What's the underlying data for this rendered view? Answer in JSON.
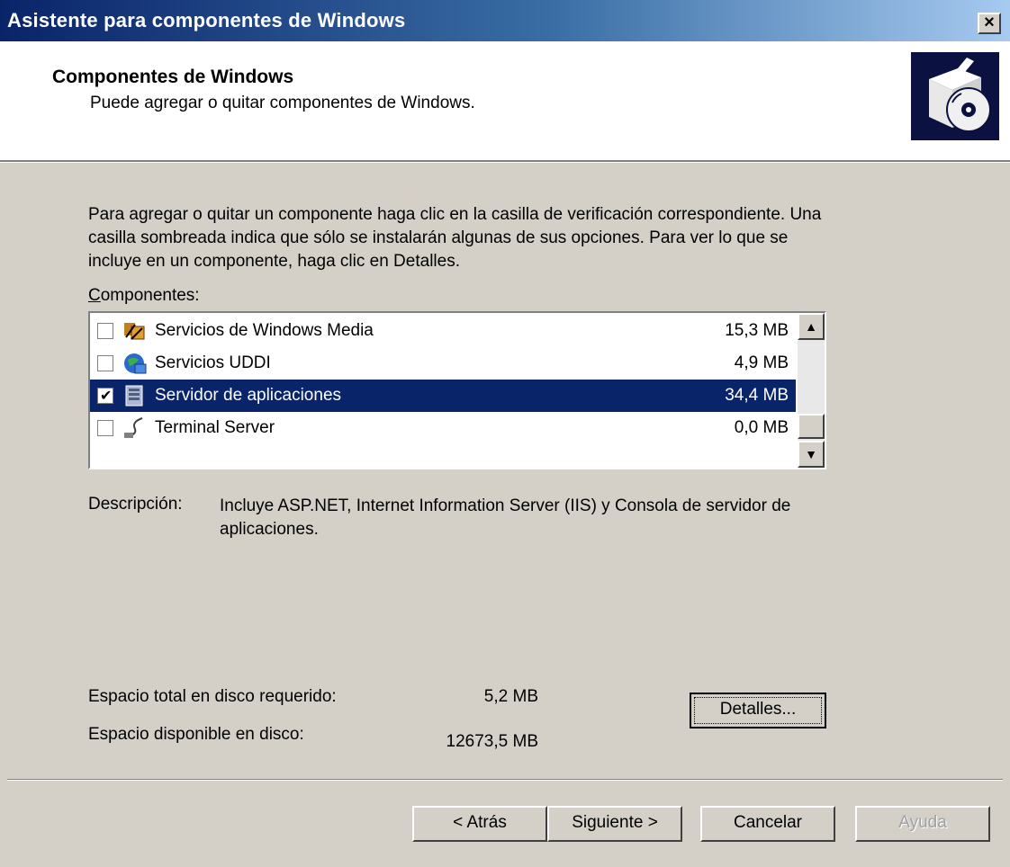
{
  "window": {
    "title": "Asistente para componentes de Windows",
    "close_label": "×"
  },
  "header": {
    "title": "Componentes de Windows",
    "subtitle": "Puede agregar o quitar componentes de Windows."
  },
  "intro_text": "Para agregar o quitar un componente haga clic en la casilla de verificación correspondiente. Una casilla sombreada indica que sólo se instalarán algunas de sus opciones. Para ver lo que se incluye en un componente, haga clic en Detalles.",
  "components_label": "Componentes:",
  "components": [
    {
      "name": "Servicios de Windows Media",
      "size": "15,3 MB",
      "checked": false,
      "selected": false,
      "icon": "media-services-icon"
    },
    {
      "name": "Servicios UDDI",
      "size": "4,9 MB",
      "checked": false,
      "selected": false,
      "icon": "uddi-globe-icon"
    },
    {
      "name": "Servidor de aplicaciones",
      "size": "34,4 MB",
      "checked": true,
      "selected": true,
      "icon": "app-server-icon"
    },
    {
      "name": "Terminal Server",
      "size": "0,0 MB",
      "checked": false,
      "selected": false,
      "icon": "terminal-server-icon"
    }
  ],
  "description": {
    "label": "Descripción:",
    "text": "Incluye ASP.NET, Internet Information Server (IIS) y Consola de servidor de aplicaciones."
  },
  "disk": {
    "required_label": "Espacio total en disco requerido:",
    "required_value": "5,2 MB",
    "available_label": "Espacio disponible en disco:",
    "available_value": "12673,5 MB"
  },
  "buttons": {
    "details": "Detalles...",
    "back": "< Atrás",
    "next": "Siguiente >",
    "cancel": "Cancelar",
    "help": "Ayuda"
  },
  "colors": {
    "selection": "#0a246a",
    "dialog_bg": "#d4d0c8",
    "title_start": "#0a246a",
    "title_end": "#a6caf0"
  }
}
